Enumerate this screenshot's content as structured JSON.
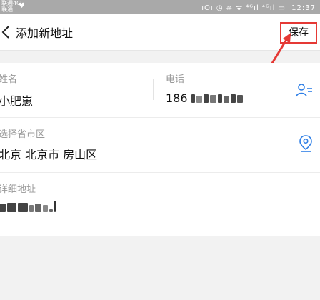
{
  "statusbar": {
    "carrier_line1": "联通4G",
    "carrier_line2": "联通",
    "right_icons": "ıOı ◷ ⎈ ᯤ ⁴ᴳıl ⁴ᴳıl ▭",
    "time": "12:37",
    "colors": {
      "background": "#a9a9a9"
    }
  },
  "navbar": {
    "title": "添加新地址",
    "save_label": "保存",
    "colors": {
      "save_border": "#e53935",
      "annotation_arrow": "#e53935"
    }
  },
  "form": {
    "name_label": "姓名",
    "name_value": "小肥崽",
    "phone_label": "电话",
    "phone_visible_prefix": "186",
    "region_label": "选择省市区",
    "region_value": "北京 北京市 房山区",
    "detail_label": "详细地址",
    "icons": {
      "contact": "contacts-icon",
      "location": "location-pin-icon"
    },
    "colors": {
      "icon_blue": "#2f7fe6"
    }
  }
}
